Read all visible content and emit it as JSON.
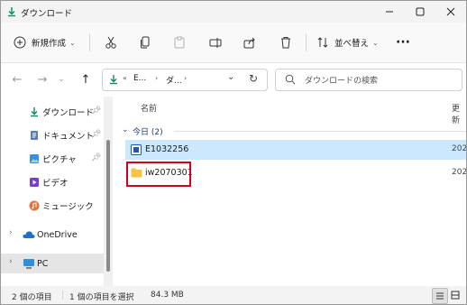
{
  "window": {
    "title": "ダウンロード"
  },
  "toolbar": {
    "new_label": "新規作成",
    "sort_label": "並べ替え"
  },
  "address": {
    "crumb1": "E...",
    "crumb2": "ダ...",
    "search_placeholder": "ダウンロードの検索"
  },
  "sidebar": {
    "items": [
      {
        "label": "ダウンロード"
      },
      {
        "label": "ドキュメント"
      },
      {
        "label": "ピクチャ"
      },
      {
        "label": "ビデオ"
      },
      {
        "label": "ミュージック"
      },
      {
        "label": "OneDrive"
      },
      {
        "label": "PC"
      }
    ]
  },
  "filelist": {
    "col_name": "名前",
    "col_date": "更新",
    "group_label": "今日 (2)",
    "rows": [
      {
        "name": "E1032256",
        "date": "202"
      },
      {
        "name": "iw2070301",
        "date": "202"
      }
    ]
  },
  "status": {
    "count": "2 個の項目",
    "selection": "1 個の項目を選択",
    "size": "84.3 MB"
  },
  "colors": {
    "accent": "#0067c0",
    "highlight_red": "#d0021b",
    "selected_row": "#cce8ff"
  }
}
